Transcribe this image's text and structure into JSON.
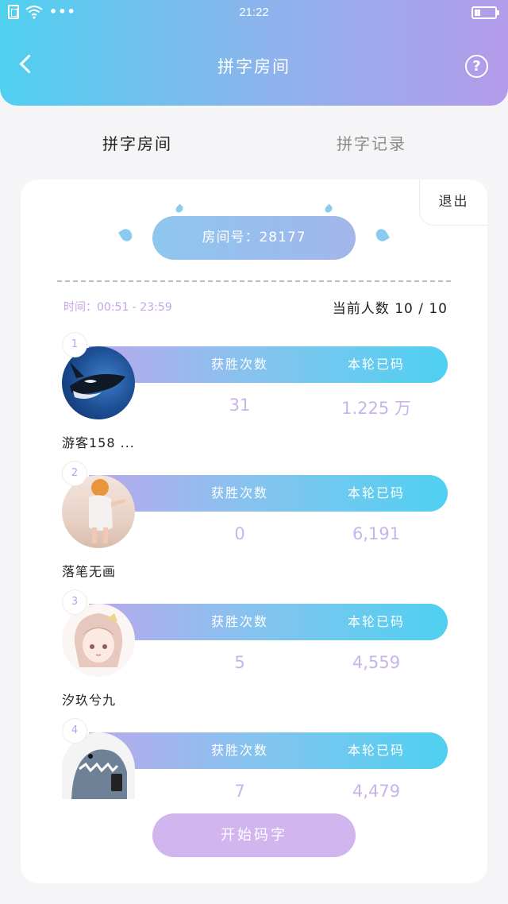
{
  "status_bar": {
    "time": "21:22",
    "dots": "•••"
  },
  "header": {
    "title": "拼字房间",
    "help_label": "?"
  },
  "tabs": [
    {
      "label": "拼字房间",
      "active": true
    },
    {
      "label": "拼字记录",
      "active": false
    }
  ],
  "room": {
    "exit_label": "退出",
    "room_number_label": "房间号：28177",
    "time_label": "时间：00:51 - 23:59",
    "people_label": "当前人数 10 / 10",
    "wins_header": "获胜次数",
    "chars_header": "本轮已码",
    "start_label": "开始码字"
  },
  "players": [
    {
      "rank": "1",
      "name": "游客158 ...",
      "wins": "31",
      "chars": "1.225 万"
    },
    {
      "rank": "2",
      "name": "落笔无画",
      "wins": "0",
      "chars": "6,191"
    },
    {
      "rank": "3",
      "name": "汐玖兮九",
      "wins": "5",
      "chars": "4,559"
    },
    {
      "rank": "4",
      "name": "",
      "wins": "7",
      "chars": "4,479"
    }
  ],
  "colors": {
    "header_start": "#4fd0ef",
    "header_end": "#b39be9",
    "accent_purple": "#c3a6e6",
    "start_button": "#d2b5ef"
  }
}
